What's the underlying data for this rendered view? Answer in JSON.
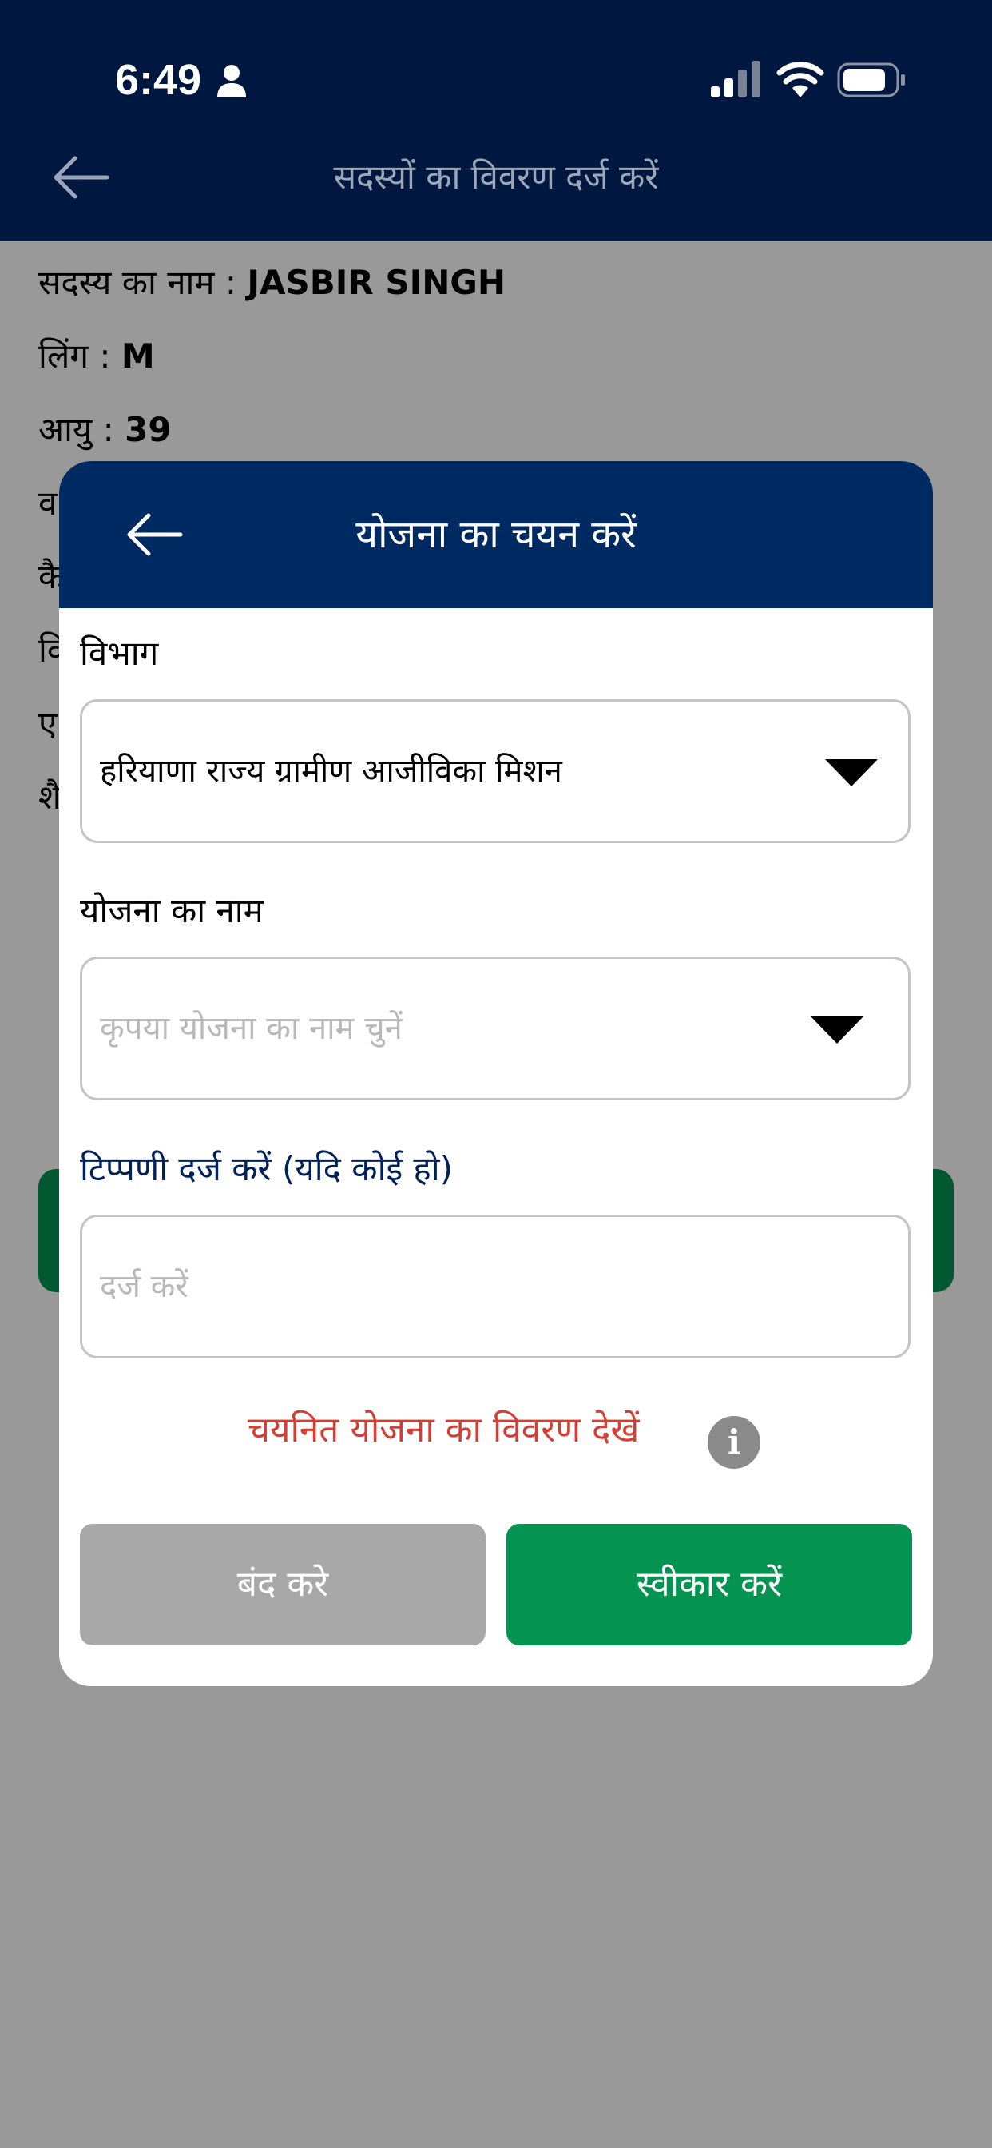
{
  "status_bar": {
    "time": "6:49"
  },
  "header": {
    "title": "सदस्यों का विवरण दर्ज करें"
  },
  "member": {
    "name_label": "सदस्य का नाम : ",
    "name_value": "JASBIR SINGH",
    "gender_label": "लिंग : ",
    "gender_value": "M",
    "age_label": "आयु : ",
    "age_value": "39",
    "partial_lines": [
      "व",
      "कै",
      "वि",
      "ए",
      "शै"
    ]
  },
  "modal": {
    "title": "योजना का चयन करें",
    "department": {
      "label": "विभाग",
      "value": "हरियाणा राज्य ग्रामीण आजीविका मिशन"
    },
    "scheme": {
      "label": "योजना का नाम",
      "placeholder": "कृपया योजना का नाम चुनें"
    },
    "remark": {
      "label": "टिप्पणी दर्ज करें (यदि कोई हो)",
      "placeholder": "दर्ज करें"
    },
    "details_link": "चयनित योजना का विवरण देखें",
    "info_glyph": "i",
    "close_button": "बंद करे",
    "accept_button": "स्वीकार करें"
  },
  "colors": {
    "header_bg": "#00173f",
    "modal_header_bg": "#002a62",
    "accent_green": "#049351",
    "link_red": "#d43f35",
    "close_gray": "#a8a8a8"
  },
  "icons": [
    "person-icon",
    "signal-icon",
    "wifi-icon",
    "battery-icon",
    "back-arrow-icon",
    "chevron-down-icon",
    "info-icon"
  ]
}
